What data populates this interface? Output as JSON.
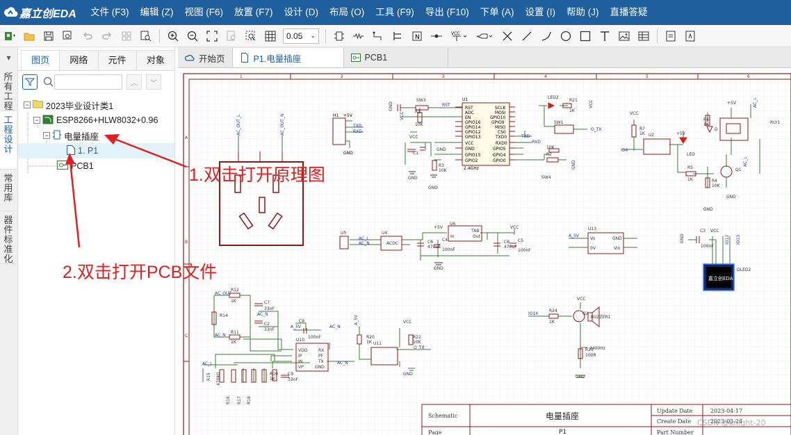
{
  "app": {
    "logo_text": "嘉立创EDA"
  },
  "menu": [
    "文件 (F3)",
    "编辑 (Z)",
    "视图 (F6)",
    "放置 (F7)",
    "设计 (D)",
    "布局 (O)",
    "工具 (F9)",
    "导出 (F10)",
    "下单 (A)",
    "设置 (I)",
    "帮助 (J)",
    "直播答疑"
  ],
  "toolbar": {
    "zoom_value": "0.05"
  },
  "side_tabs": [
    "所有工程",
    "工程设计",
    "常用库",
    "器件标准化"
  ],
  "panel": {
    "tabs": [
      "图页",
      "网络",
      "元件",
      "对象"
    ],
    "search_placeholder": "",
    "tree": {
      "project": "2023毕业设计类1",
      "board": "ESP8266+HLW8032+0.96",
      "schematic": "电量插座",
      "page": "1. P1",
      "pcb": "PCB1"
    }
  },
  "annotations": {
    "a1": "1.双击打开原理图",
    "a2": "2.双击打开PCB文件"
  },
  "editor_tabs": [
    "开始页",
    "P1.电量插座",
    "PCB1"
  ],
  "schematic": {
    "title_block": {
      "label_schematic": "Schematic",
      "label_page": "Page",
      "title": "电量插座",
      "page_value": "P1",
      "update_label": "Update Date",
      "update_date": "2023-04-17",
      "create_label": "Create Date",
      "create_date": "2023-03-24",
      "part_label": "Part Number"
    },
    "ruler_top": [
      "1",
      "2",
      "3",
      "4",
      "5",
      "6"
    ],
    "ruler_left": [
      "A",
      "B",
      "C"
    ],
    "watermark": "CSDN @knight-20",
    "labels": {
      "u1": "U1",
      "rst": "RST",
      "adc": "ADC",
      "en": "EN",
      "gpio16": "GPIO16",
      "gpio14": "GPIO14",
      "gpio12": "GPIO12",
      "gpio13": "GPIO13",
      "vcc": "VCC",
      "gnd": "GND",
      "gpio15": "GPIO15",
      "gpio2": "GPIO2",
      "module": "2.4GHz",
      "sclk": "SCLK",
      "mosi": "MOSI",
      "gpio10": "GPIO10",
      "gpio9": "GPIO9",
      "miso": "MISO",
      "cs0": "CS0",
      "txd0": "TXD0",
      "rxd0": "RXD0",
      "gpio5": "GPIO5",
      "gpio4": "GPIO4",
      "gpio0": "GPIO0",
      "sw3": "SW3",
      "r1": "R1",
      "r1v": "10K",
      "r3": "R3",
      "r3v": "10K",
      "c1": "C1",
      "led2": "LED2",
      "r21": "R21",
      "r21v": "1K",
      "sw1": "SW1",
      "otx": "O_TX",
      "txd": "TXD",
      "rxd": "RXD",
      "r2": "R2",
      "r2v": "10K",
      "sw4": "SW4",
      "r10k": "10K",
      "h1": "H1",
      "p5v": "+5V",
      "txd2": "TXD",
      "rxd2": "RXD",
      "acout_l": "AC_OUT_L",
      "acout_n": "AC_OUT_N",
      "u2": "U2",
      "r7": "R7",
      "r7v": "1K",
      "io4": "IO4",
      "led": "LED",
      "r6": "R6",
      "r6v": "1K",
      "d1": "D",
      "rly1": "RLY1",
      "r5": "R5",
      "r5v": "1K",
      "r4": "R4",
      "r4v": "10K",
      "q1": "Q1",
      "acl": "AC_L",
      "u5": "U5",
      "u4": "U4",
      "acdc": "ACDC",
      "acl2": "AC_L",
      "acn2": "AC_N",
      "c6": "C6",
      "c6v": "470uF",
      "c4": "C4",
      "c4v": "100nF",
      "u6": "U6",
      "tab": "TAB",
      "in": "In",
      "out": "Out",
      "c8": "C8",
      "c8v": "470uF",
      "c5": "C5",
      "c5v": "100nF",
      "u13": "U13",
      "a5v": "A_5V",
      "vo": "Vo",
      "vin": "Vin",
      "zero": "0V",
      "c3": "C3",
      "c3v": "100nF",
      "oled2": "OLED2",
      "oled_text": "嘉立创EDA",
      "io13": "IO13",
      "io12": "IO12",
      "r12": "R12",
      "r12v": "1K",
      "r14": "R14",
      "r11": "R11",
      "r11v": "1K",
      "c7": "C7",
      "c7v": "33nF",
      "c2": "C2",
      "c2v": "33nF",
      "acout": "AC_OUT",
      "acn3": "AC_N",
      "acn4": "AC_N",
      "u10": "U10",
      "vdd": "VDD",
      "ip": "IP",
      "inn": "IN",
      "vp": "VP",
      "rx": "RX",
      "pf": "PF",
      "tx": "TX",
      "gndu": "GND",
      "c8b": "C8",
      "c8bv": "100nF",
      "a5v2": "A_5V",
      "acn5": "AC_N",
      "r15": "R15",
      "r16": "R16",
      "r17": "R17",
      "r18": "R18",
      "r19": "R19",
      "r19v": "1K",
      "c9": "C9",
      "c9v": "33nF",
      "acl3": "AC_L",
      "r470": "470kΩ",
      "r20": "R20",
      "r20v": "1K",
      "u11": "U11",
      "r22": "R22",
      "r22v": "10K",
      "otx2": "O_TX",
      "a5v3": "A_5V",
      "io14": "IO14",
      "r24": "R24",
      "r24v": "1K",
      "q2": "Q2",
      "buzzer": "BUZZER1",
      "hz": "2400Hz",
      "r25": "R25",
      "r25v": "100R"
    }
  }
}
